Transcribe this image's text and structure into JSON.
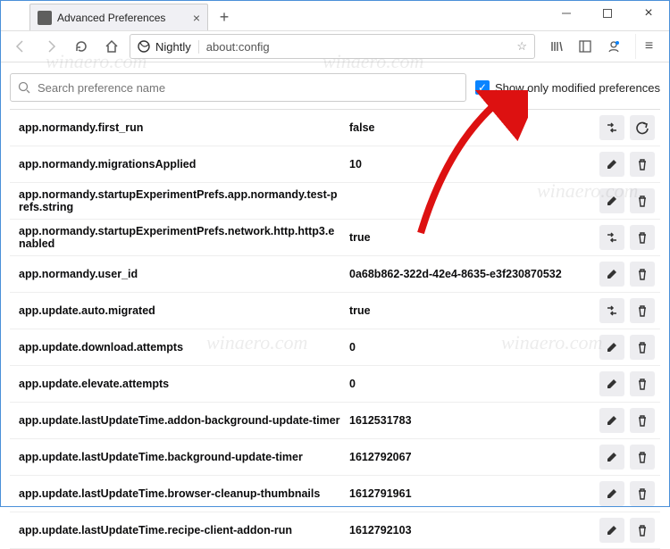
{
  "window": {
    "tab_title": "Advanced Preferences",
    "identity_label": "Nightly",
    "url": "about:config"
  },
  "search": {
    "placeholder": "Search preference name",
    "filter_label": "Show only modified preferences",
    "filter_checked": true
  },
  "prefs": [
    {
      "name": "app.normandy.first_run",
      "value": "false",
      "buttons": [
        "toggle",
        "reset"
      ]
    },
    {
      "name": "app.normandy.migrationsApplied",
      "value": "10",
      "buttons": [
        "edit",
        "delete"
      ]
    },
    {
      "name": "app.normandy.startupExperimentPrefs.app.normandy.test-prefs.string",
      "value": "",
      "buttons": [
        "edit",
        "delete"
      ]
    },
    {
      "name": "app.normandy.startupExperimentPrefs.network.http.http3.enabled",
      "value": "true",
      "buttons": [
        "toggle",
        "delete"
      ]
    },
    {
      "name": "app.normandy.user_id",
      "value": "0a68b862-322d-42e4-8635-e3f230870532",
      "buttons": [
        "edit",
        "delete"
      ]
    },
    {
      "name": "app.update.auto.migrated",
      "value": "true",
      "buttons": [
        "toggle",
        "delete"
      ]
    },
    {
      "name": "app.update.download.attempts",
      "value": "0",
      "buttons": [
        "edit",
        "delete"
      ]
    },
    {
      "name": "app.update.elevate.attempts",
      "value": "0",
      "buttons": [
        "edit",
        "delete"
      ]
    },
    {
      "name": "app.update.lastUpdateTime.addon-background-update-timer",
      "value": "1612531783",
      "buttons": [
        "edit",
        "delete"
      ]
    },
    {
      "name": "app.update.lastUpdateTime.background-update-timer",
      "value": "1612792067",
      "buttons": [
        "edit",
        "delete"
      ]
    },
    {
      "name": "app.update.lastUpdateTime.browser-cleanup-thumbnails",
      "value": "1612791961",
      "buttons": [
        "edit",
        "delete"
      ]
    },
    {
      "name": "app.update.lastUpdateTime.recipe-client-addon-run",
      "value": "1612792103",
      "buttons": [
        "edit",
        "delete"
      ]
    }
  ],
  "icons": {
    "toggle": "⇄",
    "reset": "↶",
    "edit": "✎",
    "delete": "🗑"
  },
  "watermark": "winaero.com"
}
